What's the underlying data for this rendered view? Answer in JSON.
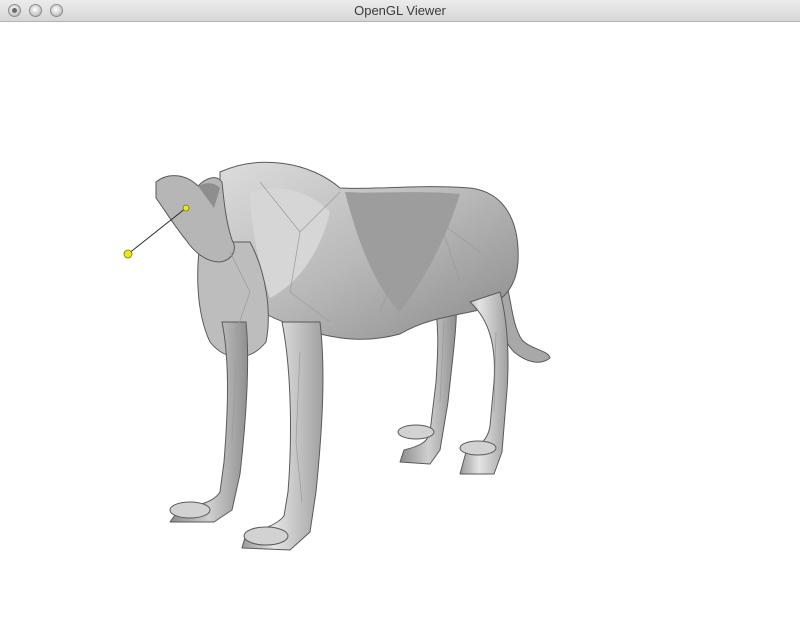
{
  "window": {
    "title": "OpenGL Viewer"
  },
  "colors": {
    "background": "#ffffff",
    "mesh_fill": "#c4c4c4",
    "mesh_dark": "#8e8e8e",
    "control_point": "#e8e81a"
  },
  "scene": {
    "model": "wolf-mesh",
    "control_point": "yellow-sphere-handle"
  }
}
